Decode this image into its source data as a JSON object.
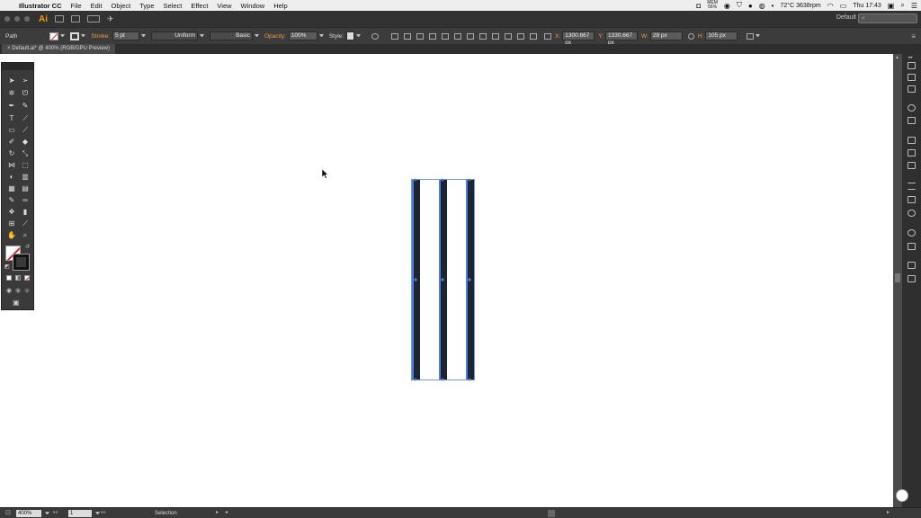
{
  "menubar": {
    "app_name": "Illustrator CC",
    "items": [
      "File",
      "Edit",
      "Object",
      "Type",
      "Select",
      "Effect",
      "View",
      "Window",
      "Help"
    ],
    "status": {
      "mem_label": "MEM",
      "mem_value": "56%",
      "temp": "72°C 3638rpm",
      "clock": "Thu 17:43"
    }
  },
  "apptitle": {
    "logo": "Ai",
    "workspace": "Default"
  },
  "control": {
    "object_type": "Path",
    "stroke_label": "Stroke:",
    "stroke_value": "5 pt",
    "profile": "Uniform",
    "brush": "Basic",
    "opacity_label": "Opacity:",
    "opacity_value": "100%",
    "style_label": "Style:",
    "x_label": "X:",
    "x_value": "1300.667 px",
    "y_label": "Y:",
    "y_value": "1330.667 px",
    "w_label": "W:",
    "w_value": "28 px",
    "h_label": "H:",
    "h_value": "105 px"
  },
  "document": {
    "tab_title": "Default.ai* @ 400% (RGB/GPU Preview)"
  },
  "status": {
    "zoom": "400%",
    "page": "1",
    "tool": "Selection"
  },
  "colors": {
    "accent": "#ff9a00",
    "selection": "#4d7fd8",
    "bar_fill": "#1b2536",
    "canvas": "#ffffff"
  }
}
